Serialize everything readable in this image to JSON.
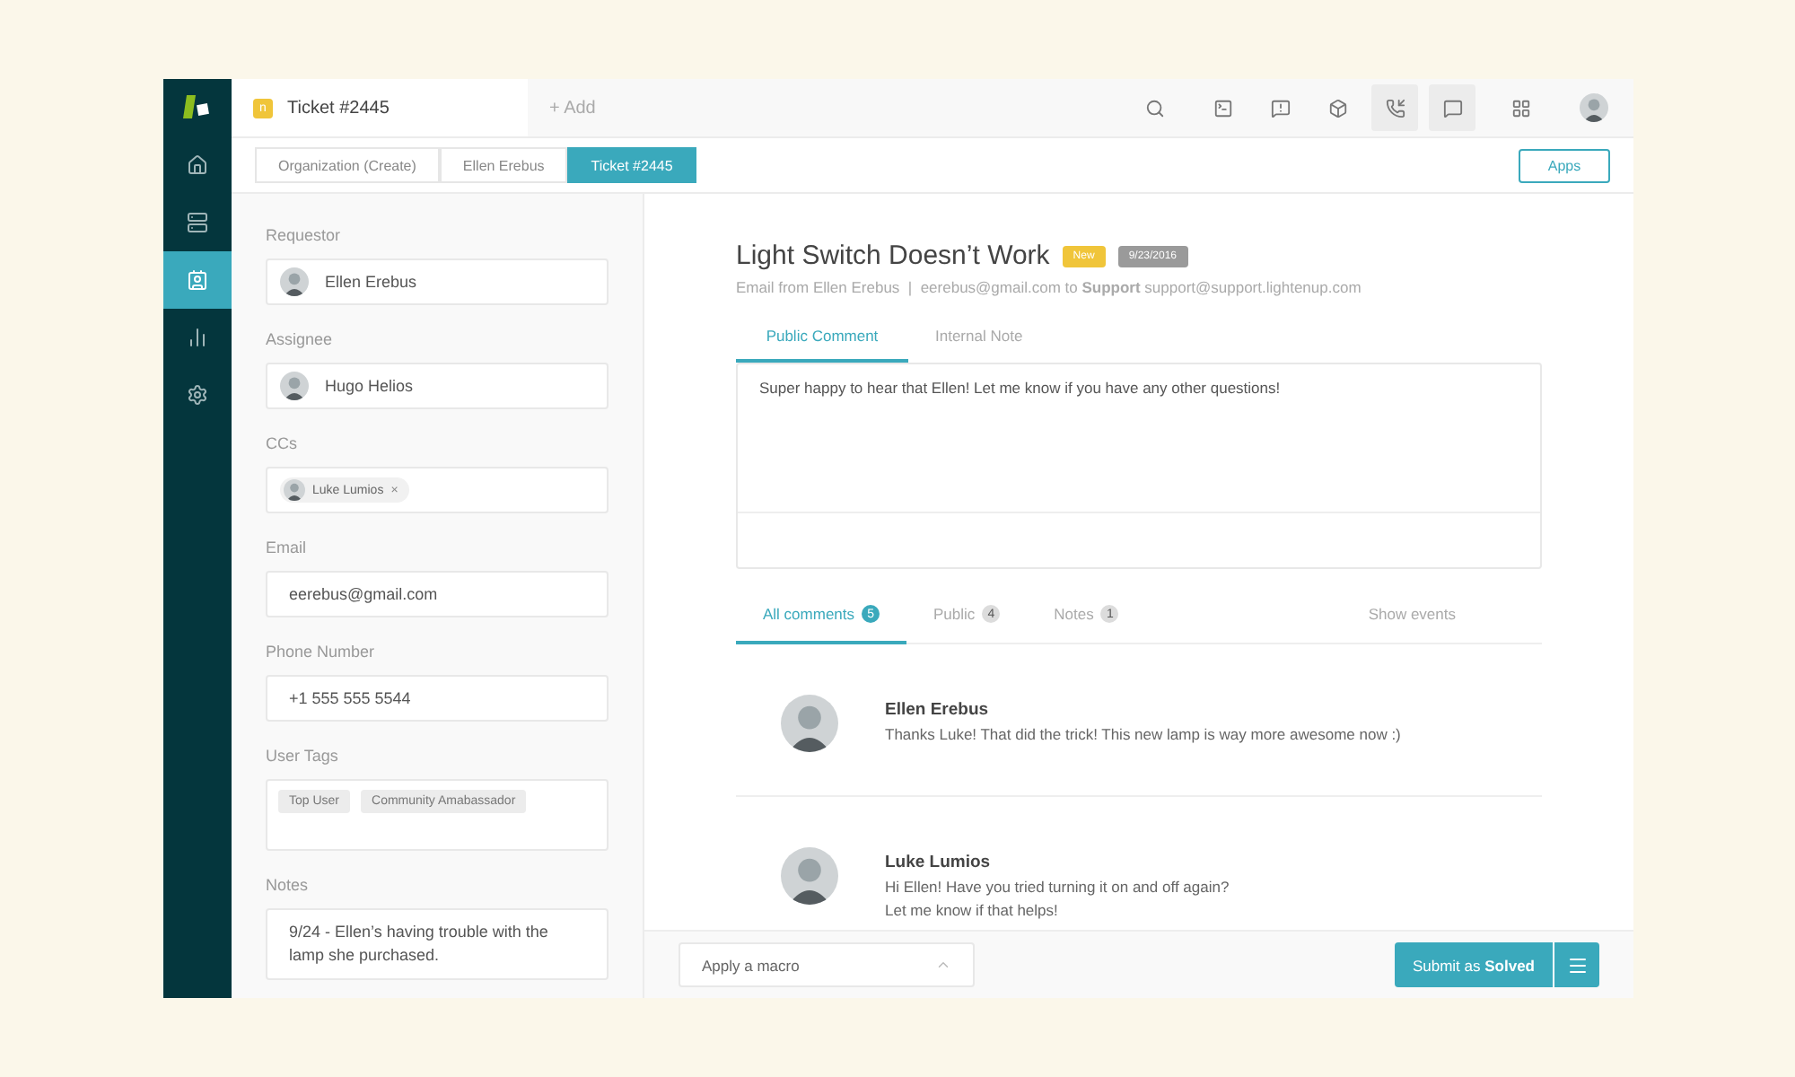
{
  "nav": [
    {
      "kind": "home",
      "selected": false
    },
    {
      "kind": "views",
      "selected": false
    },
    {
      "kind": "contacts",
      "selected": true
    },
    {
      "kind": "reports",
      "selected": false
    },
    {
      "kind": "settings",
      "selected": false
    }
  ],
  "header_tabs": [
    {
      "label": "Ticket #2445",
      "badge": "n",
      "selected": true
    },
    {
      "label": "+ Add",
      "selected": false
    }
  ],
  "toolbar": [
    {
      "kind": "search",
      "selected": false
    },
    {
      "kind": "terminal",
      "selected": false
    },
    {
      "kind": "alert",
      "selected": false
    },
    {
      "kind": "box",
      "selected": false
    },
    {
      "kind": "phone",
      "selected": true
    },
    {
      "kind": "chat",
      "selected": true
    },
    {
      "kind": "grid",
      "selected": false
    }
  ],
  "breadcrumbs": [
    {
      "label": "Organization (Create)",
      "selected": false
    },
    {
      "label": "Ellen Erebus",
      "selected": false
    },
    {
      "label": "Ticket #2445",
      "selected": true
    }
  ],
  "apps_button": "Apps",
  "fields": [
    {
      "label": "Requestor",
      "kind": "person",
      "value": "Ellen Erebus"
    },
    {
      "label": "Assignee",
      "kind": "person",
      "value": "Hugo Helios"
    },
    {
      "label": "CCs",
      "kind": "chips",
      "chips": [
        {
          "label": "Luke Lumios",
          "remove": "×"
        }
      ]
    },
    {
      "label": "Email",
      "kind": "text",
      "value": "eerebus@gmail.com"
    },
    {
      "label": "Phone Number",
      "kind": "text",
      "value": "+1 555 555 5544"
    },
    {
      "label": "User Tags",
      "kind": "tags",
      "tags": [
        "Top User",
        "Community Amabassador"
      ]
    },
    {
      "label": "Notes",
      "kind": "notes",
      "value": "9/24 - Ellen’s having trouble with the lamp she purchased."
    }
  ],
  "ticket": {
    "title": "Light Switch Doesn’t Work",
    "badges": [
      {
        "label": "New",
        "color": "#f0c53a"
      },
      {
        "label": "9/23/2016",
        "color": "#9a9a9a"
      }
    ],
    "meta": "Email from Ellen Erebus  |  eerebus@gmail.com to **Support** support@support.lightenup.com"
  },
  "reply_tabs": [
    {
      "label": "Public Comment",
      "selected": true
    },
    {
      "label": "Internal Note",
      "selected": false
    }
  ],
  "reply_text": "Super happy to hear that Ellen! Let me know if you have any other questions!",
  "comment_tabs": [
    {
      "label": "All comments",
      "count": "5",
      "selected": true
    },
    {
      "label": "Public",
      "count": "4",
      "selected": false
    },
    {
      "label": "Notes",
      "count": "1",
      "selected": false
    }
  ],
  "show_events": "Show events",
  "comments": [
    {
      "author": "Ellen Erebus",
      "lines": [
        "Thanks Luke! That did the trick! This new lamp is way more awesome now :)"
      ]
    },
    {
      "author": "Luke Lumios",
      "lines": [
        "Hi Ellen! Have you tried turning it on and off again?",
        "Let me know if that helps!"
      ]
    }
  ],
  "footer": {
    "macro": "Apply a macro",
    "submit": "Submit as **Solved**"
  }
}
